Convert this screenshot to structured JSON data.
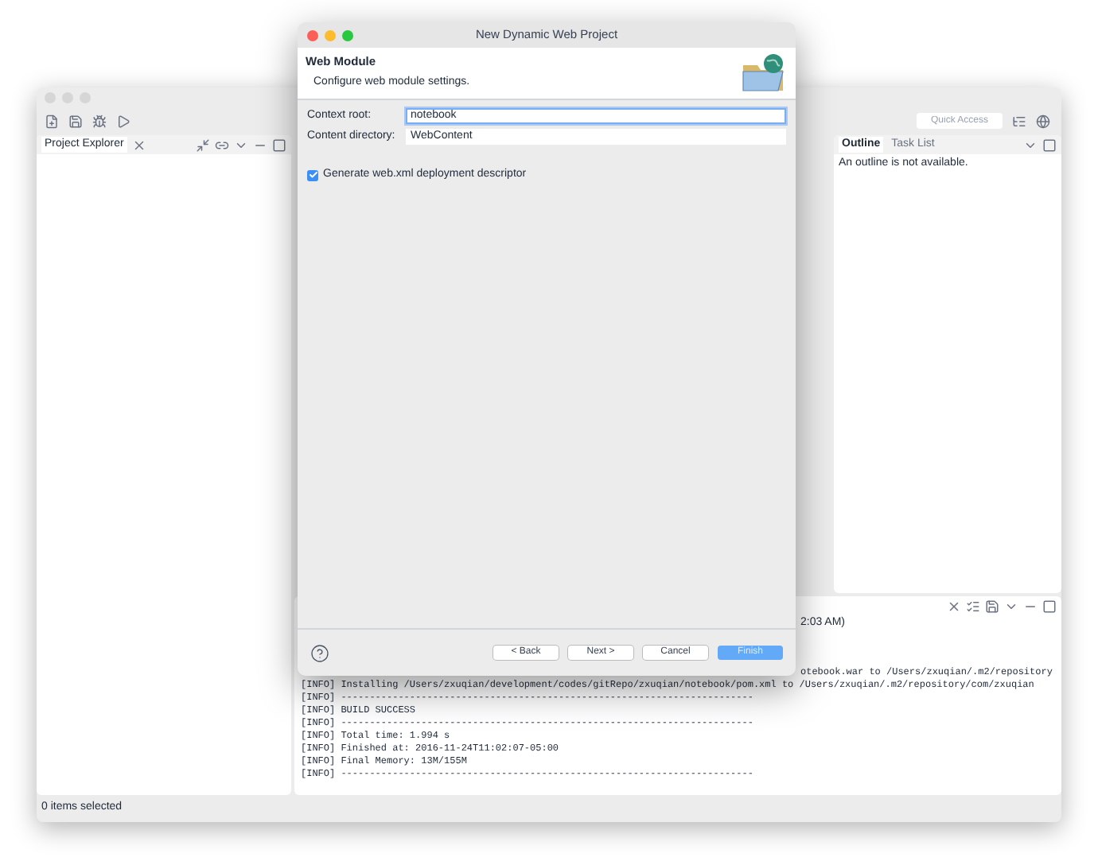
{
  "toolbar": {
    "quick_access": {
      "placeholder": "Quick Access"
    }
  },
  "left_panel": {
    "tab": "Project Explorer"
  },
  "right_panel": {
    "tabs": [
      {
        "label": "Outline",
        "selected": true
      },
      {
        "label": "Task List",
        "selected": false
      }
    ],
    "message": "An outline is not available."
  },
  "console": {
    "header": "2:03 AM)",
    "lines": [
      {
        "kind": "partial",
        "text": "otebook.war to /Users/zxuqian/.m2/repository"
      },
      {
        "kind": "full",
        "text": "[INFO] Installing /Users/zxuqian/development/codes/gitRepo/zxuqian/notebook/pom.xml to /Users/zxuqian/.m2/repository/com/zxuqian"
      },
      {
        "kind": "full",
        "text": "[INFO] ------------------------------------------------------------------------"
      },
      {
        "kind": "full",
        "text": "[INFO] BUILD SUCCESS"
      },
      {
        "kind": "full",
        "text": "[INFO] ------------------------------------------------------------------------"
      },
      {
        "kind": "full",
        "text": "[INFO] Total time: 1.994 s"
      },
      {
        "kind": "full",
        "text": "[INFO] Finished at: 2016-11-24T11:02:07-05:00"
      },
      {
        "kind": "full",
        "text": "[INFO] Final Memory: 13M/155M"
      },
      {
        "kind": "full",
        "text": "[INFO] ------------------------------------------------------------------------"
      }
    ]
  },
  "status_bar": "0 items selected",
  "dialog": {
    "title": "New Dynamic Web Project",
    "heading": "Web Module",
    "description": "Configure web module settings.",
    "fields": [
      {
        "label": "Context root:",
        "value": "notebook",
        "focused": true
      },
      {
        "label": "Content directory:",
        "value": "WebContent",
        "focused": false
      }
    ],
    "checkbox": {
      "label": "Generate web.xml deployment descriptor",
      "checked": true
    },
    "buttons": [
      {
        "label": "< Back",
        "default": false
      },
      {
        "label": "Next >",
        "default": false
      },
      {
        "label": "Cancel",
        "default": false
      },
      {
        "label": "Finish",
        "default": true
      }
    ]
  }
}
